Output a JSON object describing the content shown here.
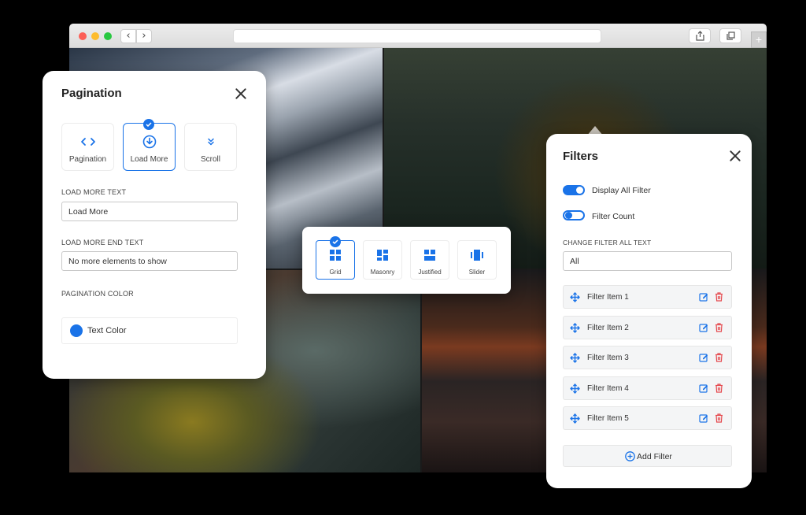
{
  "pagination": {
    "title": "Pagination",
    "options": [
      {
        "label": "Pagination",
        "icon": "code-arrows-icon",
        "selected": false
      },
      {
        "label": "Load More",
        "icon": "download-circle-icon",
        "selected": true
      },
      {
        "label": "Scroll",
        "icon": "double-chevron-down-icon",
        "selected": false
      }
    ],
    "load_more_label": "LOAD MORE TEXT",
    "load_more_value": "Load More",
    "load_more_end_label": "LOAD MORE END TEXT",
    "load_more_end_value": "No more elements to show",
    "color_label": "PAGINATION COLOR",
    "color_option": "Text Color",
    "color_value": "#1a73e8"
  },
  "layouts": {
    "items": [
      {
        "label": "Grid",
        "icon": "grid-icon",
        "selected": true
      },
      {
        "label": "Masonry",
        "icon": "masonry-icon",
        "selected": false
      },
      {
        "label": "Justified",
        "icon": "justified-icon",
        "selected": false
      },
      {
        "label": "Slider",
        "icon": "slider-icon",
        "selected": false
      }
    ]
  },
  "filters": {
    "title": "Filters",
    "display_all_label": "Display All Filter",
    "display_all_on": true,
    "filter_count_label": "Filter Count",
    "filter_count_on": false,
    "change_all_label": "CHANGE FILTER ALL TEXT",
    "change_all_value": "All",
    "items": [
      "Filter Item 1",
      "Filter Item 2",
      "Filter Item 3",
      "Filter Item 4",
      "Filter Item 5"
    ],
    "add_label": "Add Filter"
  },
  "colors": {
    "accent": "#1a73e8",
    "delete": "#e5484d"
  }
}
